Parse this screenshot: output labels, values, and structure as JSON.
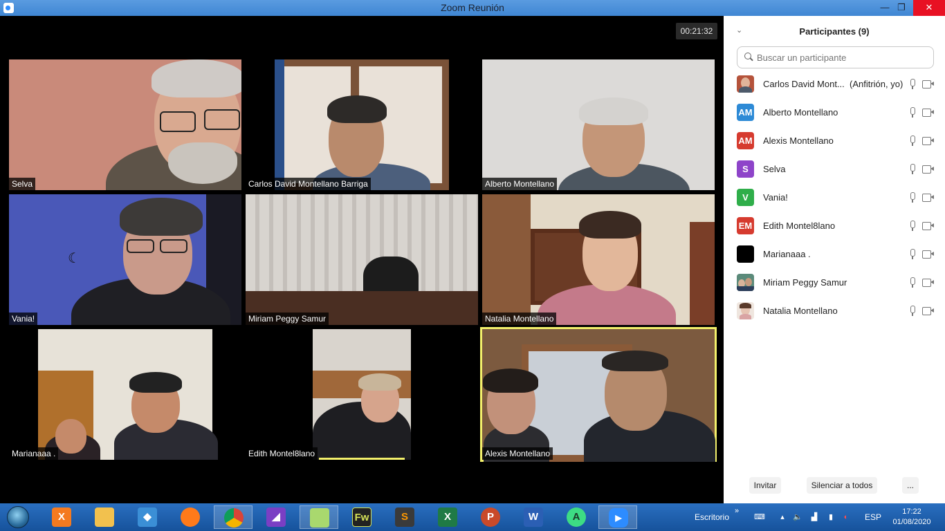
{
  "window": {
    "title": "Zoom Reunión",
    "min": "—",
    "max": "❐",
    "close": "✕"
  },
  "meeting": {
    "timer": "00:21:32"
  },
  "tiles": [
    {
      "name": "Selva"
    },
    {
      "name": "Carlos David Montellano Barriga"
    },
    {
      "name": "Alberto Montellano"
    },
    {
      "name": "Vania!"
    },
    {
      "name": "Miriam Peggy Samur"
    },
    {
      "name": "Natalia Montellano"
    },
    {
      "name": "Marianaaa ."
    },
    {
      "name": "Edith Montel8lano"
    },
    {
      "name": "Alexis Montellano"
    }
  ],
  "panel": {
    "title": "Participantes (9)",
    "search_placeholder": "Buscar un participante",
    "participants": [
      {
        "name": "Carlos David Mont...",
        "tag": "(Anfitrión, yo)",
        "initials": "",
        "color": "#b5533b"
      },
      {
        "name": "Alberto Montellano",
        "tag": "",
        "initials": "AM",
        "color": "#2d8ad6"
      },
      {
        "name": "Alexis Montellano",
        "tag": "",
        "initials": "AM",
        "color": "#d63b2f"
      },
      {
        "name": "Selva",
        "tag": "",
        "initials": "S",
        "color": "#8e44c9"
      },
      {
        "name": "Vania!",
        "tag": "",
        "initials": "V",
        "color": "#2fae4a"
      },
      {
        "name": "Edith Montel8lano",
        "tag": "",
        "initials": "EM",
        "color": "#d63b2f"
      },
      {
        "name": "Marianaaa .",
        "tag": "",
        "initials": "",
        "color": "#000000"
      },
      {
        "name": "Miriam Peggy Samur",
        "tag": "",
        "initials": "",
        "color": "#4f7c6a"
      },
      {
        "name": "Natalia Montellano",
        "tag": "",
        "initials": "",
        "color": "#e6c4b3"
      }
    ],
    "footer": {
      "invite": "Invitar",
      "mute_all": "Silenciar a todos",
      "more": "..."
    }
  },
  "taskbar": {
    "apps": [
      {
        "icon": "xampp-icon",
        "label": "X",
        "color": "#f47a20"
      },
      {
        "icon": "file-explorer-icon",
        "label": "",
        "color": "#f2c14e"
      },
      {
        "icon": "git-icon",
        "label": "◆",
        "color": "#3b8fd6"
      },
      {
        "icon": "firefox-icon",
        "label": "",
        "color": "#ff7a1a"
      },
      {
        "icon": "chrome-icon",
        "label": "",
        "color": "#2aa44f"
      },
      {
        "icon": "visual-studio-icon",
        "label": "◢",
        "color": "#7a3fc4"
      },
      {
        "icon": "folder-icon",
        "label": "",
        "color": "#a9d86e"
      },
      {
        "icon": "fireworks-icon",
        "label": "Fw",
        "color": "#222222"
      },
      {
        "icon": "sublime-icon",
        "label": "S",
        "color": "#3a3a3a"
      },
      {
        "icon": "excel-icon",
        "label": "X",
        "color": "#1f7a45"
      },
      {
        "icon": "powerpoint-icon",
        "label": "P",
        "color": "#c94a2a"
      },
      {
        "icon": "word-icon",
        "label": "W",
        "color": "#2b5fb4"
      },
      {
        "icon": "android-studio-icon",
        "label": "A",
        "color": "#3ddc84"
      },
      {
        "icon": "zoom-icon",
        "label": "▶",
        "color": "#2d8cff"
      }
    ],
    "desktop_label": "Escritorio",
    "language": "ESP",
    "time": "17:22",
    "date": "01/08/2020"
  }
}
